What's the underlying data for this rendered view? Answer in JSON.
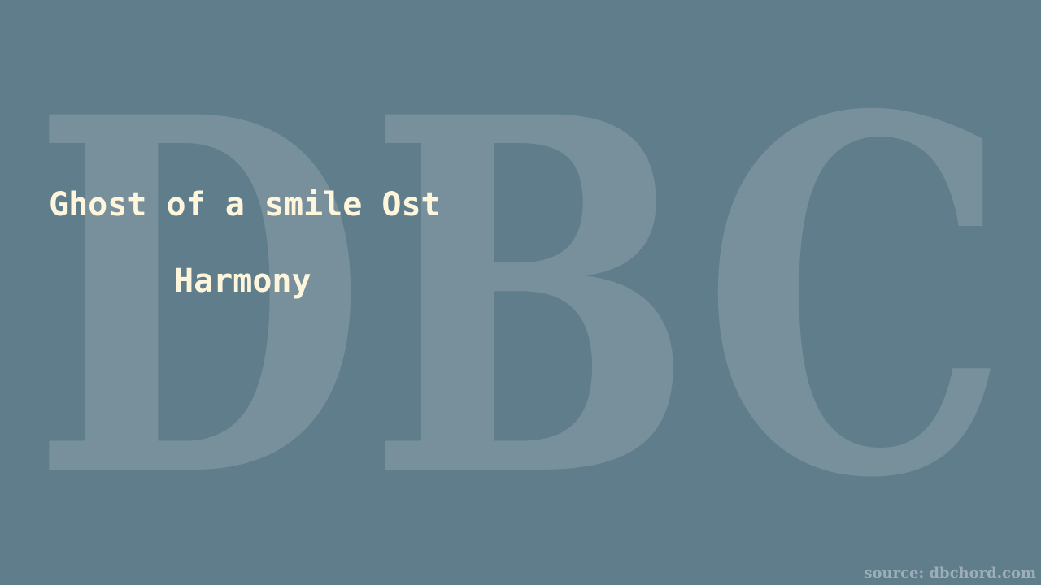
{
  "background_color": "#607d8b",
  "text_color": "#fdf5dc",
  "watermark": {
    "text": "DBC"
  },
  "title": "Ghost of a smile Ost",
  "subtitle": "Harmony",
  "source": "source: dbchord.com"
}
